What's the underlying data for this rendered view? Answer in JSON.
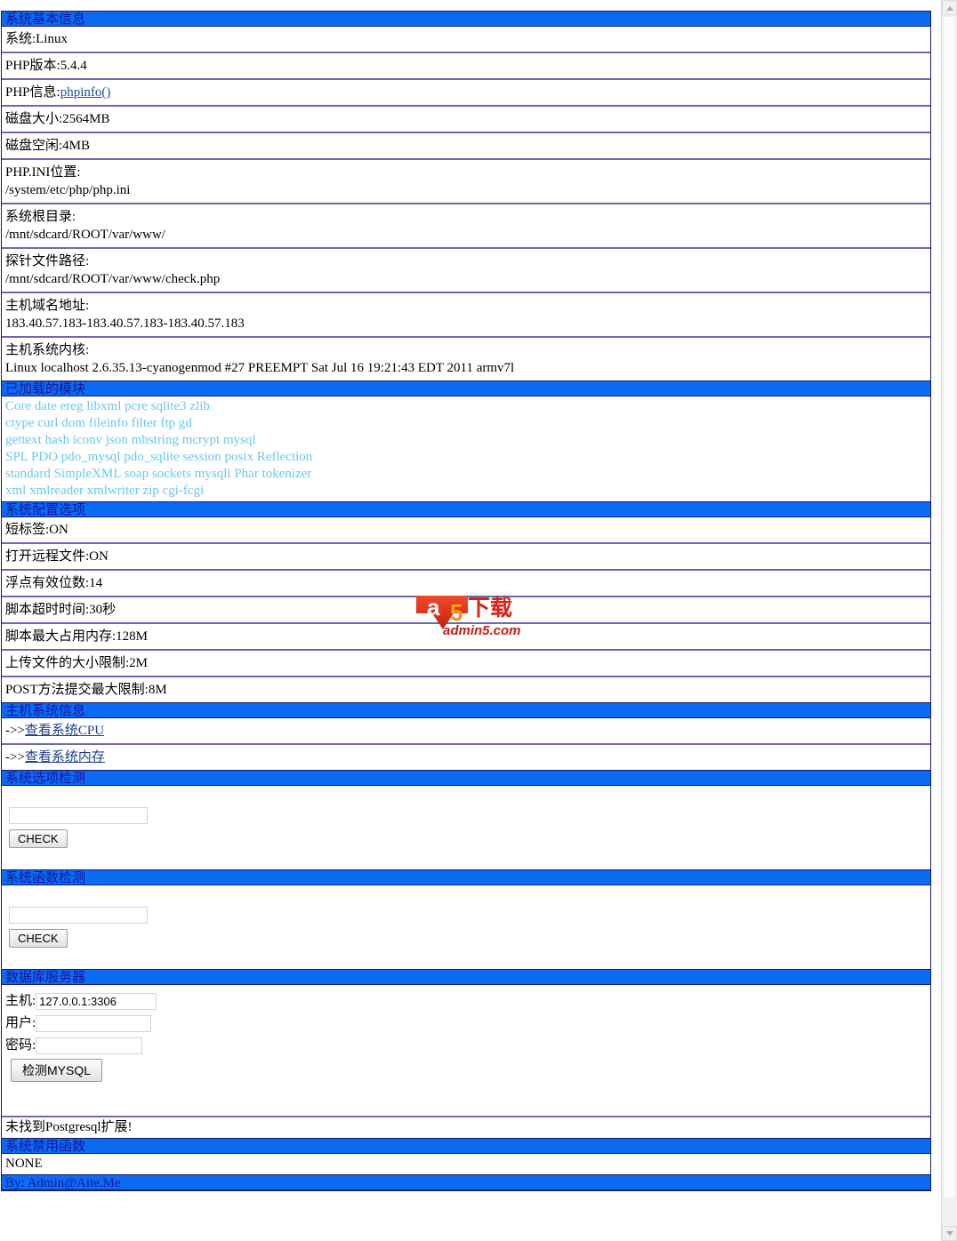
{
  "colors": {
    "header_bg": "#0b6bf2",
    "header_text": "#16169b",
    "border": "#191970",
    "row_separator": "#6a6ab0",
    "module_text": "#6ec6f0",
    "link": "#1b4fa0"
  },
  "sections": {
    "basic_info": {
      "title": "系统基本信息",
      "rows": [
        {
          "label": "系统:",
          "value": "Linux"
        },
        {
          "label": "PHP版本:",
          "value": "5.4.4"
        },
        {
          "label": "PHP信息:",
          "value": "phpinfo()",
          "is_link": true
        },
        {
          "label": "磁盘大小:",
          "value": "2564MB"
        },
        {
          "label": "磁盘空闲:",
          "value": "4MB"
        }
      ],
      "paths": [
        {
          "label": "PHP.INI位置:",
          "value": "/system/etc/php/php.ini"
        },
        {
          "label": "系统根目录:",
          "value": "/mnt/sdcard/ROOT/var/www/"
        },
        {
          "label": "探针文件路径:",
          "value": "/mnt/sdcard/ROOT/var/www/check.php"
        },
        {
          "label": "主机域名地址:",
          "value": "183.40.57.183-183.40.57.183-183.40.57.183"
        },
        {
          "label": "主机系统内核:",
          "value": "Linux localhost 2.6.35.13-cyanogenmod #27 PREEMPT Sat Jul 16 19:21:43 EDT 2011 armv7l"
        }
      ]
    },
    "modules": {
      "title": "已加载的模块",
      "lines": [
        "Core date ereg libxml pcre sqlite3 zlib",
        "ctype curl dom fileinfo filter ftp gd",
        "gettext hash iconv json mbstring mcrypt mysql",
        "SPL PDO pdo_mysql pdo_sqlite session posix Reflection",
        "standard SimpleXML soap sockets mysqli Phar tokenizer",
        "xml xmlreader xmlwriter zip cgi-fcgi"
      ]
    },
    "config": {
      "title": "系统配置选项",
      "rows": [
        {
          "label": "短标签:",
          "value": "ON"
        },
        {
          "label": "打开远程文件:",
          "value": "ON"
        },
        {
          "label": "浮点有效位数:",
          "value": "14"
        },
        {
          "label": "脚本超时时间:",
          "value": "30秒"
        },
        {
          "label": "脚本最大占用内存:",
          "value": "128M"
        },
        {
          "label": "上传文件的大小限制:",
          "value": "2M"
        },
        {
          "label": "POST方法提交最大限制:",
          "value": "8M"
        }
      ]
    },
    "host_info": {
      "title": "主机系统信息",
      "links": [
        {
          "prefix": "->>",
          "label": "查看系统CPU"
        },
        {
          "prefix": "->>",
          "label": "查看系统内存"
        }
      ]
    },
    "option_check": {
      "title": "系统选项检测",
      "input_value": "",
      "input_placeholder": "",
      "button_label": "CHECK"
    },
    "function_check": {
      "title": "系统函数检测",
      "input_value": "",
      "input_placeholder": "",
      "button_label": "CHECK"
    },
    "database": {
      "title": "数据库服务器",
      "fields": [
        {
          "label": "主机:",
          "value": "127.0.0.1:3306"
        },
        {
          "label": "用户:",
          "value": ""
        },
        {
          "label": "密码:",
          "value": ""
        }
      ],
      "button_label": "检测MYSQL",
      "postgres_message": "未找到Postgresql扩展!"
    },
    "disabled_functions": {
      "title": "系统禁用函数",
      "value": "NONE"
    },
    "footer": {
      "text": "By: Admin@Aite.Me"
    }
  },
  "watermark": {
    "name": "a5-download-logo",
    "mark": "a",
    "digit": "5",
    "chinese": "下载",
    "domain": "admin5.com"
  }
}
